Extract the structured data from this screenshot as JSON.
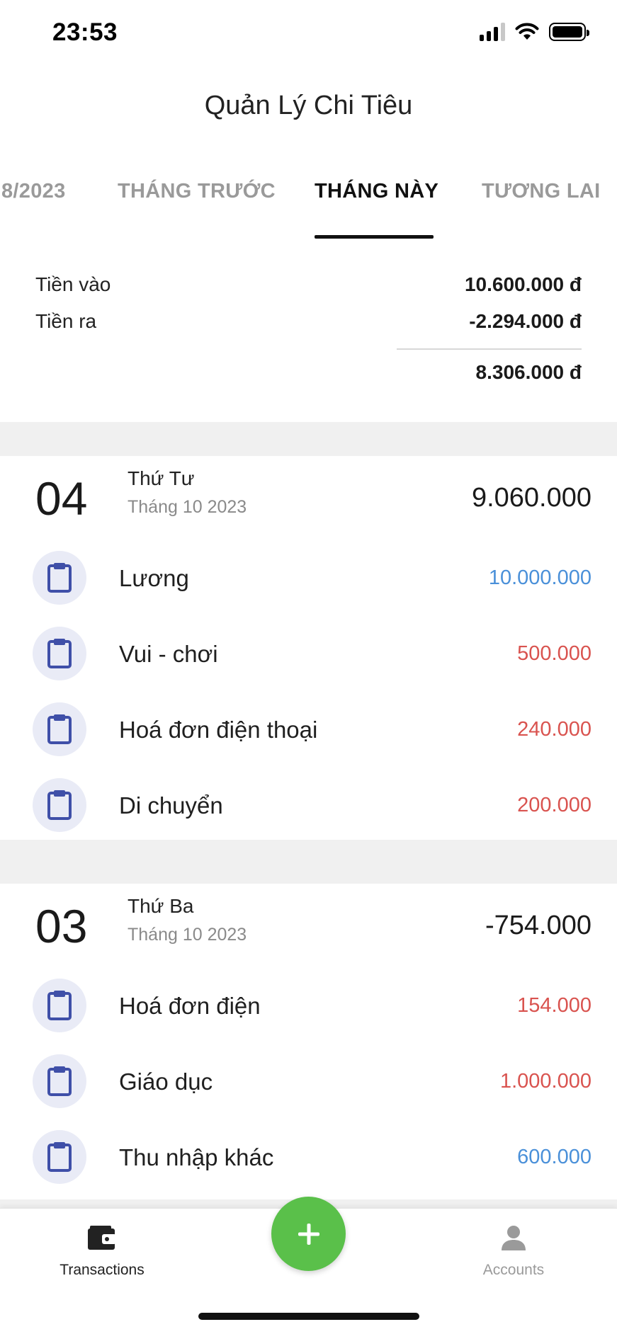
{
  "status_bar": {
    "time": "23:53"
  },
  "app": {
    "title": "Quản Lý Chi Tiêu"
  },
  "tabs": [
    {
      "label": "8/2023",
      "active": false
    },
    {
      "label": "THÁNG TRƯỚC",
      "active": false
    },
    {
      "label": "THÁNG NÀY",
      "active": true
    },
    {
      "label": "TƯƠNG LAI",
      "active": false
    }
  ],
  "summary": {
    "income_label": "Tiền vào",
    "income_value": "10.600.000 đ",
    "expense_label": "Tiền ra",
    "expense_value": "-2.294.000 đ",
    "balance_value": "8.306.000 đ"
  },
  "colors": {
    "income": "#4a90d9",
    "expense": "#d9534f",
    "fab": "#5ac04a",
    "icon": "#3f4fa8",
    "icon_bg": "#e9ebf6"
  },
  "days": [
    {
      "day": "04",
      "weekday": "Thứ Tư",
      "month": "Tháng 10 2023",
      "total": "9.060.000",
      "transactions": [
        {
          "icon": "clipboard-icon",
          "name": "Lương",
          "amount": "10.000.000",
          "type": "income"
        },
        {
          "icon": "clipboard-icon",
          "name": "Vui - chơi",
          "amount": "500.000",
          "type": "expense"
        },
        {
          "icon": "clipboard-icon",
          "name": "Hoá đơn điện thoại",
          "amount": "240.000",
          "type": "expense"
        },
        {
          "icon": "clipboard-icon",
          "name": "Di chuyển",
          "amount": "200.000",
          "type": "expense"
        }
      ]
    },
    {
      "day": "03",
      "weekday": "Thứ Ba",
      "month": "Tháng 10 2023",
      "total": "-754.000",
      "transactions": [
        {
          "icon": "clipboard-icon",
          "name": "Hoá đơn điện",
          "amount": "154.000",
          "type": "expense"
        },
        {
          "icon": "clipboard-icon",
          "name": "Giáo dục",
          "amount": "1.000.000",
          "type": "expense"
        },
        {
          "icon": "clipboard-icon",
          "name": "Thu nhập khác",
          "amount": "600.000",
          "type": "income"
        }
      ]
    }
  ],
  "bottom_nav": {
    "left_label": "Transactions",
    "left_icon": "wallet-icon",
    "fab_icon": "plus-icon",
    "right_label": "Accounts",
    "right_icon": "person-icon"
  }
}
